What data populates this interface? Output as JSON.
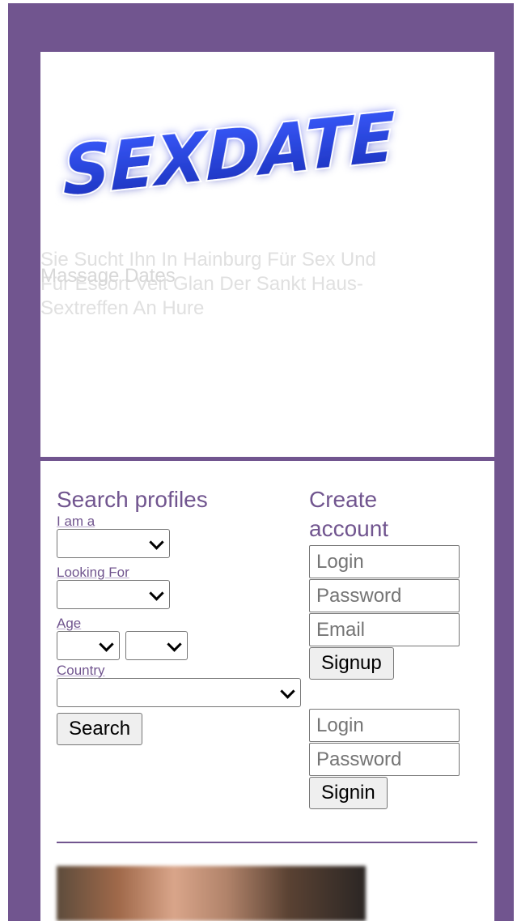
{
  "header": {
    "logo_text": "SEXDATE",
    "tagline_line1": "Sie Sucht Ihn In Hainburg Für Sex Und",
    "tagline_line2": "Für Escort Veit Glan Der Sankt Haus-",
    "tagline_ghost": "Massage Dates",
    "tagline_line3": "Sextreffen An Hure"
  },
  "search": {
    "title": "Search profiles",
    "i_am_label": "I am a",
    "looking_for_label": "Looking For",
    "age_label": "Age",
    "country_label": "Country",
    "search_button": "Search"
  },
  "signup": {
    "title_line1": "Create",
    "title_line2": "account",
    "login_placeholder": "Login",
    "password_placeholder": "Password",
    "email_placeholder": "Email",
    "signup_button": "Signup"
  },
  "signin": {
    "login_placeholder": "Login",
    "password_placeholder": "Password",
    "signin_button": "Signin"
  },
  "colors": {
    "frame": "#71558f",
    "accent_text": "#71558f",
    "logo_blue": "#1f3fd6"
  }
}
